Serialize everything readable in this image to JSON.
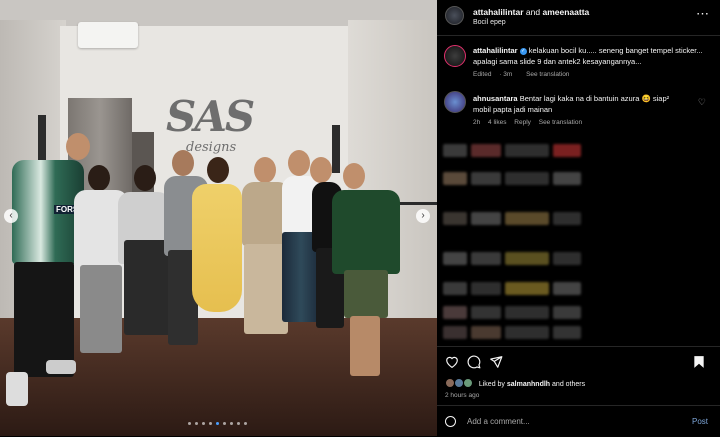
{
  "photo": {
    "logo_main": "SAS",
    "logo_sub": "designs",
    "shirt_text": "FORSA",
    "carousel_dots": 9,
    "carousel_active_index": 4
  },
  "header": {
    "user1": "attahalilintar",
    "joiner": "and",
    "user2": "ameenaatta",
    "subtitle": "Bocil epep",
    "more_icon": "ellipsis-icon"
  },
  "caption": {
    "username": "attahalilintar",
    "text": "kelakuan bocil ku..... seneng banget tempel sticker... apalagi sama slide 9 dan antek2 kesayangannya...",
    "edited": "Edited",
    "age": "3m",
    "see_translation": "See translation"
  },
  "comment": {
    "username": "ahnusantara",
    "text": "Bentar lagi kaka na di bantuin azura 😆 siap² mobil papta jadi mainan",
    "age": "2h",
    "likes": "4 likes",
    "reply": "Reply",
    "see_translation": "See translation"
  },
  "blurred_rows": [
    {
      "colors": [
        "#3a3a3a",
        "#5a2a2a",
        "#2e2e2e",
        "#7a2020"
      ]
    },
    {
      "colors": [
        "#5a4a3a",
        "#3a3a3a",
        "#2e2e2e",
        "#444"
      ]
    },
    {
      "colors": [
        "#3a3530",
        "#444",
        "#5a4a2a",
        "#2e2e2e"
      ]
    },
    {
      "colors": [
        "#444",
        "#3a3a3a",
        "#5a5020",
        "#2e2e2e"
      ]
    },
    {
      "colors": [
        "#3a3a3a",
        "#2e2e2e",
        "#6a5a20",
        "#444"
      ]
    },
    {
      "colors": [
        "#4a3a3a",
        "#333",
        "#2e2e2e",
        "#3a3a3a"
      ]
    },
    {
      "colors": [
        "#3a3030",
        "#4a3a30",
        "#2e2e2e",
        "#333"
      ]
    }
  ],
  "footer": {
    "liked_prefix": "Liked by",
    "liked_user": "salmanhndlh",
    "liked_suffix": "and others",
    "time": "2 hours ago",
    "add_comment_placeholder": "Add a comment...",
    "post_label": "Post"
  },
  "colors": {
    "verified": "#3897f0",
    "link": "#7da5d8",
    "muted": "#a8a8a8"
  }
}
